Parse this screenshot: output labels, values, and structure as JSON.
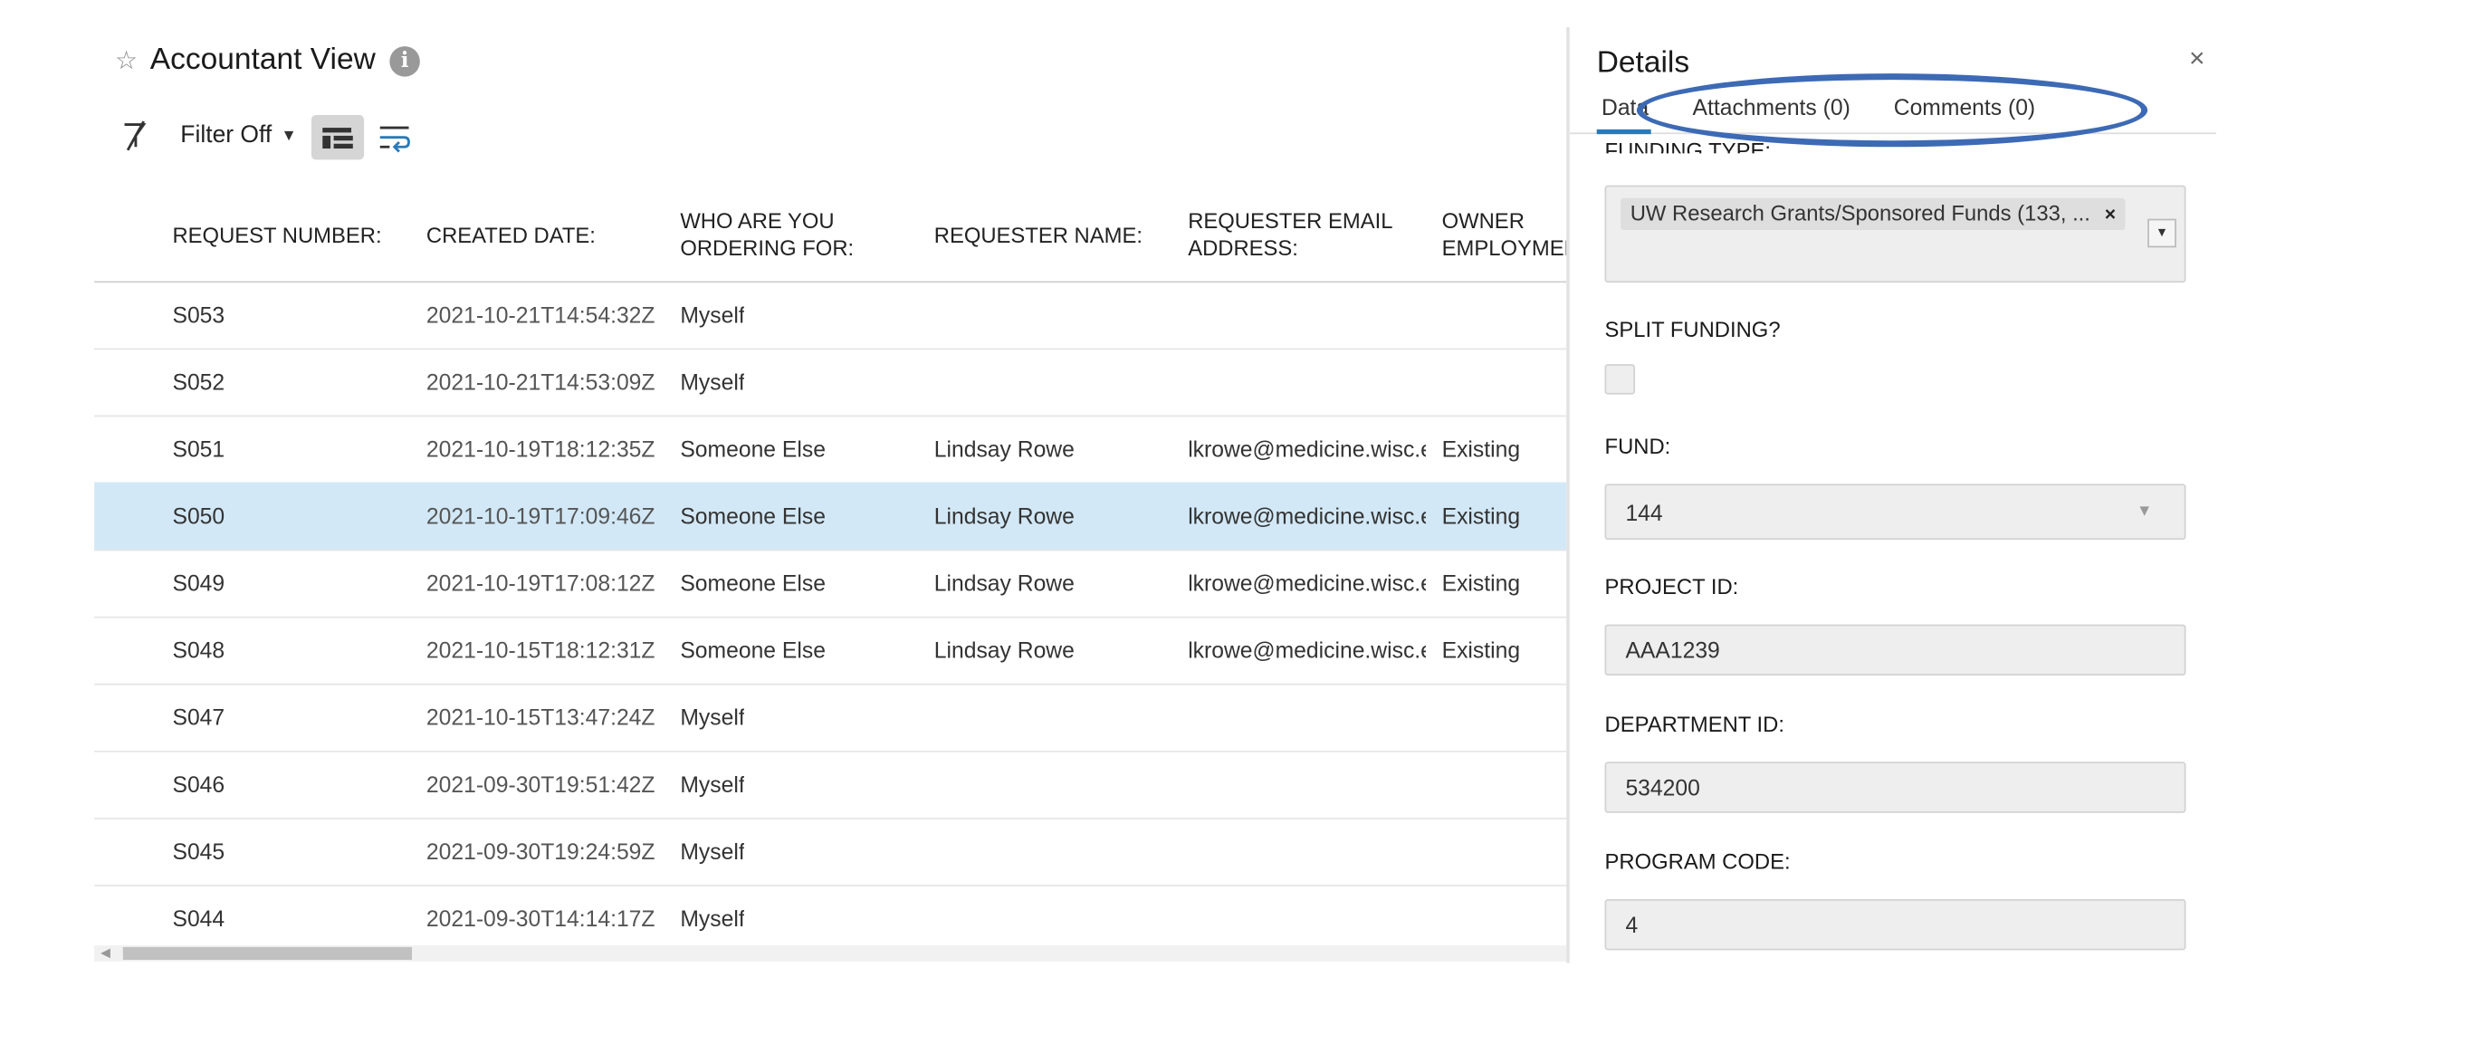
{
  "view": {
    "title": "Accountant View"
  },
  "toolbar": {
    "filter_label": "Filter Off"
  },
  "grid": {
    "columns": [
      "REQUEST NUMBER:",
      "CREATED DATE:",
      "WHO ARE YOU ORDERING FOR:",
      "REQUESTER NAME:",
      "REQUESTER EMAIL ADDRESS:",
      "OWNER EMPLOYMEN"
    ],
    "rows": [
      [
        "S053",
        "2021-10-21T14:54:32Z",
        "Myself",
        "",
        "",
        ""
      ],
      [
        "S052",
        "2021-10-21T14:53:09Z",
        "Myself",
        "",
        "",
        ""
      ],
      [
        "S051",
        "2021-10-19T18:12:35Z",
        "Someone Else",
        "Lindsay Rowe",
        "lkrowe@medicine.wisc.e",
        "Existing"
      ],
      [
        "S050",
        "2021-10-19T17:09:46Z",
        "Someone Else",
        "Lindsay Rowe",
        "lkrowe@medicine.wisc.e",
        "Existing"
      ],
      [
        "S049",
        "2021-10-19T17:08:12Z",
        "Someone Else",
        "Lindsay Rowe",
        "lkrowe@medicine.wisc.e",
        "Existing"
      ],
      [
        "S048",
        "2021-10-15T18:12:31Z",
        "Someone Else",
        "Lindsay Rowe",
        "lkrowe@medicine.wisc.e",
        "Existing"
      ],
      [
        "S047",
        "2021-10-15T13:47:24Z",
        "Myself",
        "",
        "",
        ""
      ],
      [
        "S046",
        "2021-09-30T19:51:42Z",
        "Myself",
        "",
        "",
        ""
      ],
      [
        "S045",
        "2021-09-30T19:24:59Z",
        "Myself",
        "",
        "",
        ""
      ],
      [
        "S044",
        "2021-09-30T14:14:17Z",
        "Myself",
        "",
        "",
        ""
      ]
    ],
    "selected_request": "S050"
  },
  "details": {
    "title": "Details",
    "close_glyph": "×",
    "tabs": [
      "Data",
      "Attachments (0)",
      "Comments (0)"
    ],
    "active_tab": "Data",
    "fields": {
      "funding_type_label": "FUNDING TYPE:",
      "funding_type_value": "UW Research Grants/Sponsored Funds (133, ...",
      "split_funding_label": "SPLIT FUNDING?",
      "fund_label": "FUND:",
      "fund_value": "144",
      "project_id_label": "PROJECT ID:",
      "project_id_value": "AAA1239",
      "department_id_label": "DEPARTMENT ID:",
      "department_id_value": "534200",
      "program_code_label": "PROGRAM CODE:",
      "program_code_value": "4"
    }
  },
  "annotation": {
    "color": "#3d6ab5"
  }
}
